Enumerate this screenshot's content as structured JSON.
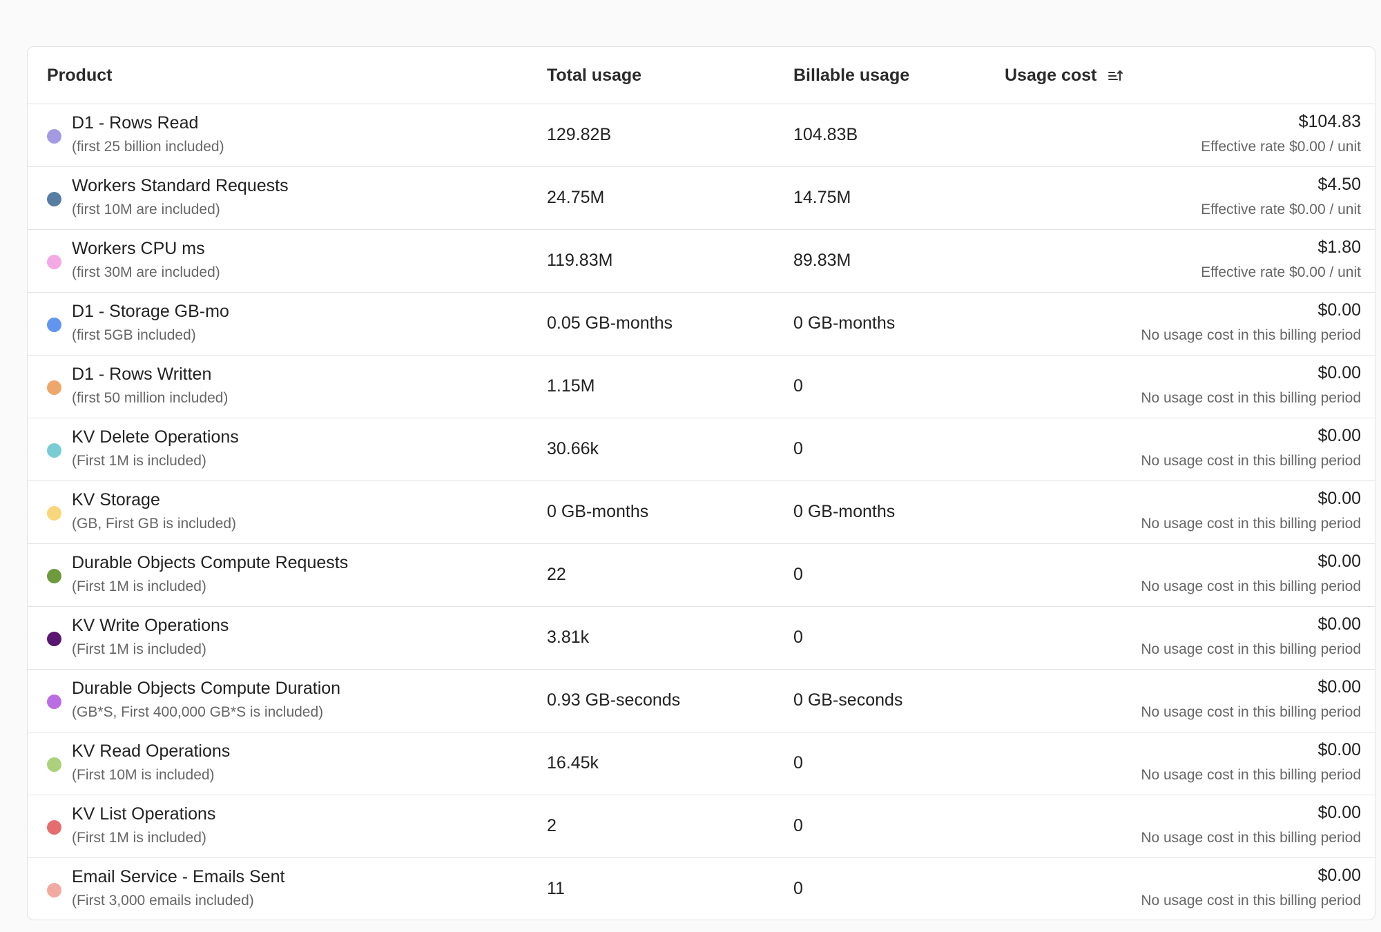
{
  "table": {
    "headers": {
      "product": "Product",
      "total_usage": "Total usage",
      "billable_usage": "Billable usage",
      "usage_cost": "Usage cost"
    },
    "rows": [
      {
        "name": "D1 - Rows Read",
        "sub": "(first 25 billion included)",
        "color": "#a49ae3",
        "total": "129.82B",
        "billable": "104.83B",
        "cost": "$104.83",
        "note": "Effective rate $0.00 / unit"
      },
      {
        "name": "Workers Standard Requests",
        "sub": "(first 10M are included)",
        "color": "#577da3",
        "total": "24.75M",
        "billable": "14.75M",
        "cost": "$4.50",
        "note": "Effective rate $0.00 / unit"
      },
      {
        "name": "Workers CPU ms",
        "sub": "(first 30M are included)",
        "color": "#f3a9e3",
        "total": "119.83M",
        "billable": "89.83M",
        "cost": "$1.80",
        "note": "Effective rate $0.00 / unit"
      },
      {
        "name": "D1 - Storage GB-mo",
        "sub": "(first 5GB included)",
        "color": "#6195ef",
        "total": "0.05 GB-months",
        "billable": "0 GB-months",
        "cost": "$0.00",
        "note": "No usage cost in this billing period"
      },
      {
        "name": "D1 - Rows Written",
        "sub": "(first 50 million included)",
        "color": "#eea76a",
        "total": "1.15M",
        "billable": "0",
        "cost": "$0.00",
        "note": "No usage cost in this billing period"
      },
      {
        "name": "KV Delete Operations",
        "sub": "(First 1M is included)",
        "color": "#79ccd3",
        "total": "30.66k",
        "billable": "0",
        "cost": "$0.00",
        "note": "No usage cost in this billing period"
      },
      {
        "name": "KV Storage",
        "sub": "(GB, First GB is included)",
        "color": "#f8d77c",
        "total": "0 GB-months",
        "billable": "0 GB-months",
        "cost": "$0.00",
        "note": "No usage cost in this billing period"
      },
      {
        "name": "Durable Objects Compute Requests",
        "sub": "(First 1M is included)",
        "color": "#6d9a3c",
        "total": "22",
        "billable": "0",
        "cost": "$0.00",
        "note": "No usage cost in this billing period"
      },
      {
        "name": "KV Write Operations",
        "sub": "(First 1M is included)",
        "color": "#5a1570",
        "total": "3.81k",
        "billable": "0",
        "cost": "$0.00",
        "note": "No usage cost in this billing period"
      },
      {
        "name": "Durable Objects Compute Duration",
        "sub": "(GB*S, First 400,000 GB*S is included)",
        "color": "#bb6ee3",
        "total": "0.93 GB-seconds",
        "billable": "0 GB-seconds",
        "cost": "$0.00",
        "note": "No usage cost in this billing period"
      },
      {
        "name": "KV Read Operations",
        "sub": "(First 10M is included)",
        "color": "#a9d27a",
        "total": "16.45k",
        "billable": "0",
        "cost": "$0.00",
        "note": "No usage cost in this billing period"
      },
      {
        "name": "KV List Operations",
        "sub": "(First 1M is included)",
        "color": "#e56d6d",
        "total": "2",
        "billable": "0",
        "cost": "$0.00",
        "note": "No usage cost in this billing period"
      },
      {
        "name": "Email Service - Emails Sent",
        "sub": "(First 3,000 emails included)",
        "color": "#f2a9a0",
        "total": "11",
        "billable": "0",
        "cost": "$0.00",
        "note": "No usage cost in this billing period"
      }
    ]
  },
  "icons": {
    "sort": "sort-ascending-icon"
  }
}
